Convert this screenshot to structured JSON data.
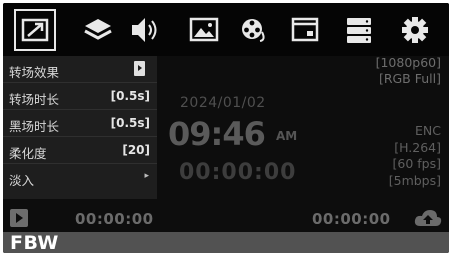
{
  "toolbar": {
    "items": [
      {
        "icon": "expand-icon",
        "selected": true
      },
      {
        "icon": "layers-icon"
      },
      {
        "icon": "speaker-icon"
      },
      {
        "icon": "image-icon"
      },
      {
        "icon": "film-reel-icon"
      },
      {
        "icon": "window-icon"
      },
      {
        "icon": "storage-icon"
      },
      {
        "icon": "gear-icon"
      }
    ]
  },
  "status_top": {
    "resolution": "[1080p60]",
    "color_format": "[RGB Full]"
  },
  "clock": {
    "date": "2024/01/02",
    "time": "09:46",
    "ampm": "AM",
    "timecode": "00:00:00"
  },
  "encoder": {
    "label": "ENC",
    "codec": "[H.264]",
    "fps": "[60 fps]",
    "bitrate": "[5mbps]"
  },
  "menu": {
    "items": [
      {
        "label": "转场效果",
        "value": "",
        "type": "toggle"
      },
      {
        "label": "转场时长",
        "value": "[0.5s]",
        "type": "value"
      },
      {
        "label": "黑场时长",
        "value": "[0.5s]",
        "type": "value"
      },
      {
        "label": "柔化度",
        "value": "[20]",
        "type": "value"
      },
      {
        "label": "淡入",
        "value": "",
        "type": "submenu"
      }
    ]
  },
  "statusbar": {
    "left_timecode": "00:00:00",
    "right_timecode": "00:00:00"
  },
  "footer": {
    "label": "FBW"
  },
  "colors": {
    "screen_bg": "#0d0d0d",
    "menu_bg": "#1e1e1e",
    "footer_bg": "#525252",
    "icon": "#e8e8e8"
  }
}
